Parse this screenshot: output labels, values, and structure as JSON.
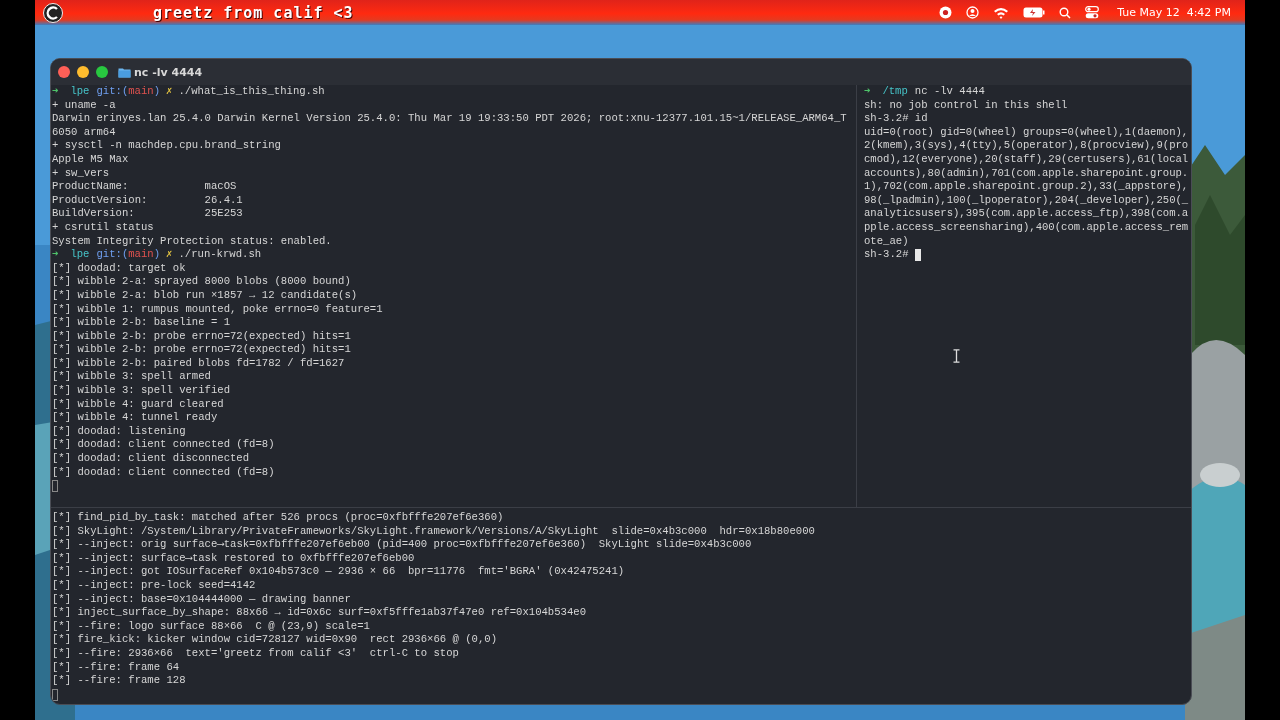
{
  "menu_bar": {
    "banner": "greetz from calif <3",
    "clock": "Tue May 12  4:42 PM"
  },
  "window": {
    "title": "nc -lv 4444",
    "panes": [
      {
        "focused": false,
        "cursor": true,
        "lines": [
          {
            "kind": "prompt",
            "arrow": "➜",
            "dir": "lpe",
            "git_open": "git:(",
            "branch": "main",
            "git_close": ")",
            "dirty": "✗",
            "command": "./what_is_this_thing.sh"
          },
          {
            "kind": "text",
            "text": "+ uname -a"
          },
          {
            "kind": "text",
            "text": "Darwin erinyes.lan 25.4.0 Darwin Kernel Version 25.4.0: Thu Mar 19 19:33:50 PDT 2026; root:xnu-12377.101.15~1/RELEASE_ARM64_T"
          },
          {
            "kind": "text",
            "text": "6050 arm64"
          },
          {
            "kind": "text",
            "text": "+ sysctl -n machdep.cpu.brand_string"
          },
          {
            "kind": "text",
            "text": "Apple M5 Max"
          },
          {
            "kind": "text",
            "text": "+ sw_vers"
          },
          {
            "kind": "text",
            "text": "ProductName:            macOS"
          },
          {
            "kind": "text",
            "text": "ProductVersion:         26.4.1"
          },
          {
            "kind": "text",
            "text": "BuildVersion:           25E253"
          },
          {
            "kind": "text",
            "text": "+ csrutil status"
          },
          {
            "kind": "text",
            "text": "System Integrity Protection status: enabled."
          },
          {
            "kind": "prompt",
            "arrow": "➜",
            "dir": "lpe",
            "git_open": "git:(",
            "branch": "main",
            "git_close": ")",
            "dirty": "✗",
            "command": "./run-krwd.sh"
          },
          {
            "kind": "text",
            "text": "[*] doodad: target ok"
          },
          {
            "kind": "text",
            "text": "[*] wibble 2-a: sprayed 8000 blobs (8000 bound)"
          },
          {
            "kind": "text",
            "text": "[*] wibble 2-a: blob run ×1857 → 12 candidate(s)"
          },
          {
            "kind": "text",
            "text": "[*] wibble 1: rumpus mounted, poke errno=0 feature=1"
          },
          {
            "kind": "text",
            "text": "[*] wibble 2-b: baseline = 1"
          },
          {
            "kind": "text",
            "text": "[*] wibble 2-b: probe errno=72(expected) hits=1"
          },
          {
            "kind": "text",
            "text": "[*] wibble 2-b: probe errno=72(expected) hits=1"
          },
          {
            "kind": "text",
            "text": "[*] wibble 2-b: paired blobs fd=1782 / fd=1627"
          },
          {
            "kind": "text",
            "text": "[*] wibble 3: spell armed"
          },
          {
            "kind": "text",
            "text": "[*] wibble 3: spell verified"
          },
          {
            "kind": "text",
            "text": "[*] wibble 4: guard cleared"
          },
          {
            "kind": "text",
            "text": "[*] wibble 4: tunnel ready"
          },
          {
            "kind": "text",
            "text": "[*] doodad: listening"
          },
          {
            "kind": "text",
            "text": "[*] doodad: client connected (fd=8)"
          },
          {
            "kind": "text",
            "text": "[*] doodad: client disconnected"
          },
          {
            "kind": "text",
            "text": "[*] doodad: client connected (fd=8)"
          }
        ]
      },
      {
        "focused": true,
        "cursor": true,
        "lines": [
          {
            "kind": "prompt",
            "arrow": "➜",
            "dir": "/tmp",
            "command": "nc -lv 4444"
          },
          {
            "kind": "text",
            "text": "sh: no job control in this shell"
          },
          {
            "kind": "text",
            "text": "sh-3.2# id"
          },
          {
            "kind": "text",
            "text": "uid=0(root) gid=0(wheel) groups=0(wheel),1(daemon),"
          },
          {
            "kind": "text",
            "text": "2(kmem),3(sys),4(tty),5(operator),8(procview),9(pro"
          },
          {
            "kind": "text",
            "text": "cmod),12(everyone),20(staff),29(certusers),61(local"
          },
          {
            "kind": "text",
            "text": "accounts),80(admin),701(com.apple.sharepoint.group."
          },
          {
            "kind": "text",
            "text": "1),702(com.apple.sharepoint.group.2),33(_appstore),"
          },
          {
            "kind": "text",
            "text": "98(_lpadmin),100(_lpoperator),204(_developer),250(_"
          },
          {
            "kind": "text",
            "text": "analyticsusers),395(com.apple.access_ftp),398(com.a"
          },
          {
            "kind": "text",
            "text": "pple.access_screensharing),400(com.apple.access_rem"
          },
          {
            "kind": "text",
            "text": "ote_ae)"
          },
          {
            "kind": "text",
            "text": "sh-3.2#"
          }
        ]
      },
      {
        "focused": false,
        "cursor": true,
        "lines": [
          {
            "kind": "text",
            "text": "[*] find_pid_by_task: matched after 526 procs (proc=0xfbfffe207ef6e360)"
          },
          {
            "kind": "text",
            "text": "[*] SkyLight: /System/Library/PrivateFrameworks/SkyLight.framework/Versions/A/SkyLight  slide=0x4b3c000  hdr=0x18b80e000"
          },
          {
            "kind": "text",
            "text": "[*] --inject: orig surface⟶task=0xfbfffe207ef6eb00 (pid=400 proc=0xfbfffe207ef6e360)  SkyLight slide=0x4b3c000"
          },
          {
            "kind": "text",
            "text": "[*] --inject: surface⟶task restored to 0xfbfffe207ef6eb00"
          },
          {
            "kind": "text",
            "text": "[*] --inject: got IOSurfaceRef 0x104b573c0 — 2936 × 66  bpr=11776  fmt='BGRA' (0x42475241)"
          },
          {
            "kind": "text",
            "text": "[*] --inject: pre-lock seed=4142"
          },
          {
            "kind": "text",
            "text": "[*] --inject: base=0x104444000 — drawing banner"
          },
          {
            "kind": "text",
            "text": "[*] inject_surface_by_shape: 88x66 → id=0x6c surf=0xf5fffe1ab37f47e0 ref=0x104b534e0"
          },
          {
            "kind": "text",
            "text": "[*] --fire: logo surface 88×66  C @ (23,9) scale=1"
          },
          {
            "kind": "text",
            "text": "[*] fire_kick: kicker window cid=728127 wid=0x90  rect 2936×66 @ (0,0)"
          },
          {
            "kind": "text",
            "text": "[*] --fire: 2936×66  text='greetz from calif <3'  ctrl-C to stop"
          },
          {
            "kind": "text",
            "text": "[*] --fire: frame 64"
          },
          {
            "kind": "text",
            "text": "[*] --fire: frame 128"
          }
        ]
      }
    ]
  }
}
